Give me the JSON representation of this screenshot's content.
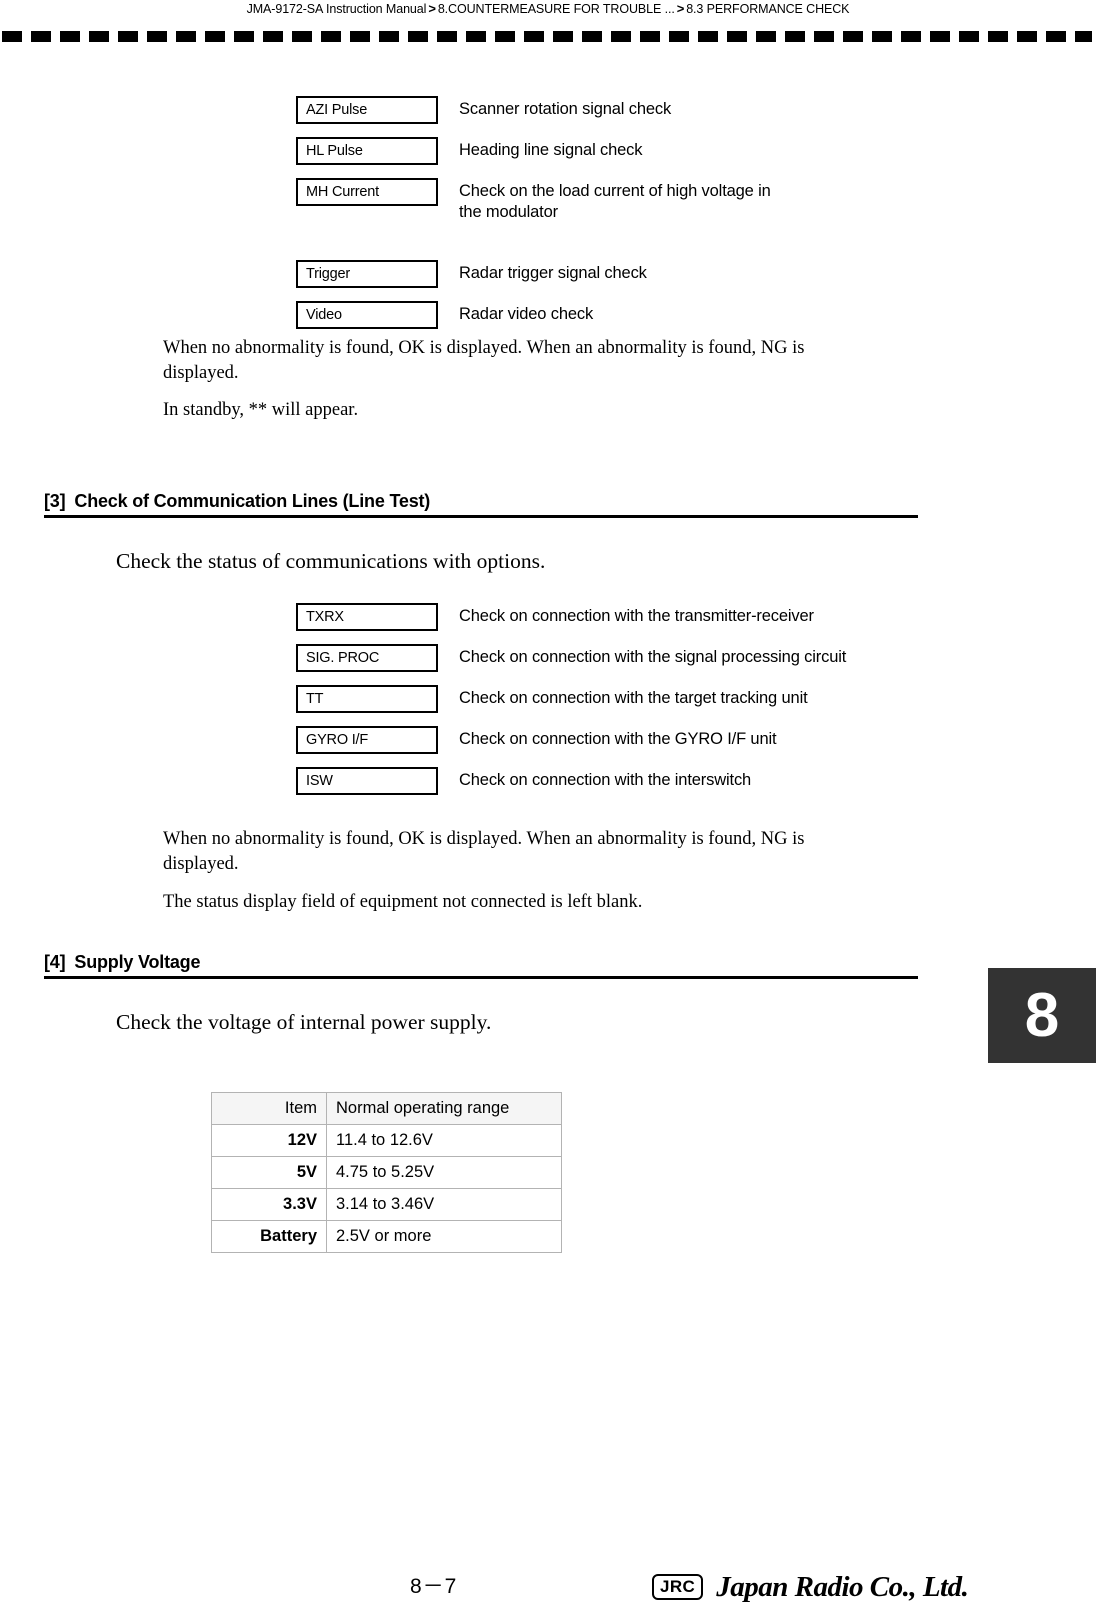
{
  "header": {
    "breadcrumb": [
      "JMA-9172-SA Instruction Manual",
      "8.COUNTERMEASURE FOR TROUBLE ...",
      "8.3  PERFORMANCE CHECK"
    ],
    "separator": ">"
  },
  "signal_checks": {
    "items": [
      {
        "code": "AZI Pulse",
        "desc": "Scanner rotation signal check"
      },
      {
        "code": "HL Pulse",
        "desc": "Heading line signal check"
      },
      {
        "code": "MH Current",
        "desc": "Check on the load current of high voltage in\nthe modulator"
      },
      {
        "code": "Trigger",
        "desc": "Radar trigger signal check"
      },
      {
        "code": "Video",
        "desc": "Radar video check"
      }
    ],
    "note1": "When no abnormality is found, OK is displayed. When an abnormality is found, NG is displayed.",
    "note2": "In standby, ** will appear."
  },
  "section3": {
    "number": "[3]",
    "title": "Check of Communication Lines (Line Test)",
    "intro": "Check the status of communications with options.",
    "items": [
      {
        "code": "TXRX",
        "desc": "Check on connection with the transmitter-receiver"
      },
      {
        "code": "SIG. PROC",
        "desc": "Check on connection with the signal processing circuit"
      },
      {
        "code": "TT",
        "desc": "Check on connection with the target tracking unit"
      },
      {
        "code": "GYRO I/F",
        "desc": "Check on connection with the GYRO I/F unit"
      },
      {
        "code": "ISW",
        "desc": "Check on connection with the interswitch"
      }
    ],
    "note1": "When no abnormality is found, OK is displayed. When an abnormality is found, NG is displayed.",
    "note2": "The status display field of equipment not connected is left blank."
  },
  "section4": {
    "number": "[4]",
    "title": "Supply Voltage",
    "intro": "Check the voltage of internal power supply.",
    "table": {
      "headers": [
        "Item",
        "Normal operating range"
      ],
      "rows": [
        [
          "12V",
          "11.4 to 12.6V"
        ],
        [
          "5V",
          "4.75 to 5.25V"
        ],
        [
          "3.3V",
          "3.14 to 3.46V"
        ],
        [
          "Battery",
          "2.5V or more"
        ]
      ]
    }
  },
  "chapter_tab": {
    "label": "8"
  },
  "footer": {
    "page_number": "8－7",
    "logo_mark": "JRC",
    "logo_text": "Japan Radio Co., Ltd."
  },
  "colors": {
    "tab_background": "#333333",
    "table_header_background": "#f5f5f5",
    "table_border": "#b3b3b3",
    "text": "#000000"
  }
}
